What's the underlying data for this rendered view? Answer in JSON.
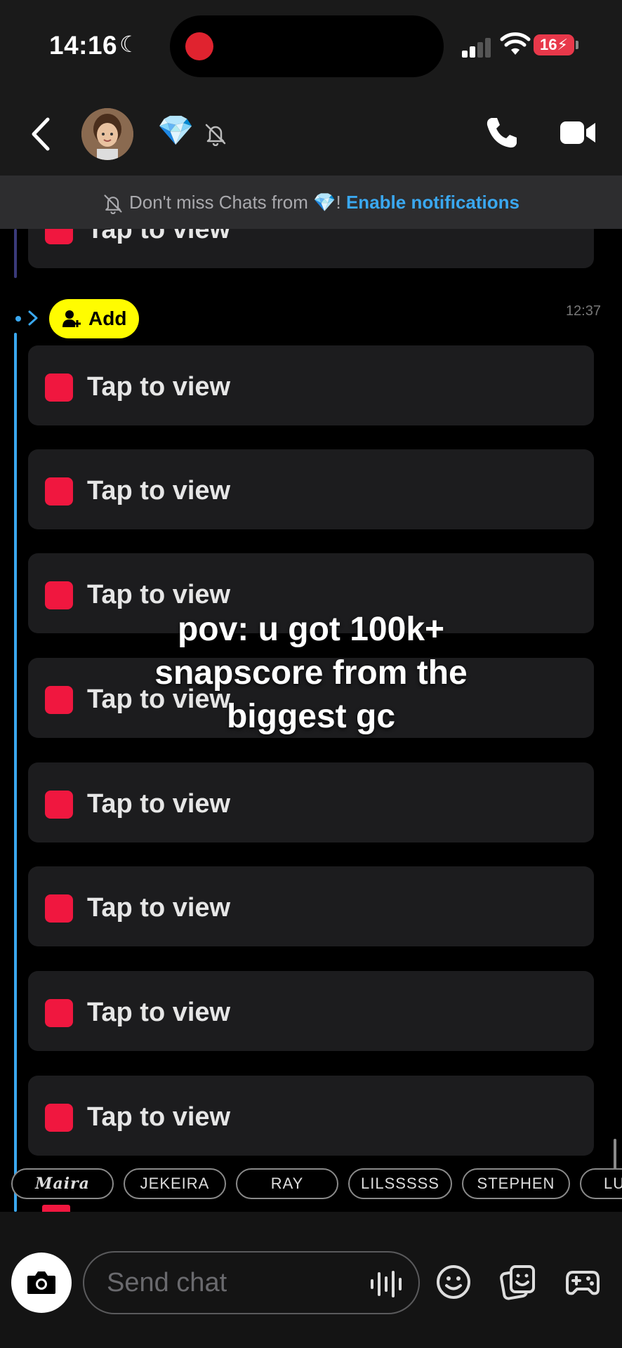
{
  "status_bar": {
    "time": "14:16",
    "battery": "16"
  },
  "header": {
    "gem_emoji": "💎",
    "icons": [
      "back-chevron-icon",
      "avatar",
      "bell-off-icon",
      "phone-icon",
      "video-icon"
    ]
  },
  "banner": {
    "prefix": "Don't miss Chats from ",
    "gem": "💎",
    "bang": "!",
    "link": "Enable notifications"
  },
  "chat": {
    "add_label": "Add",
    "timestamp": "12:37",
    "snap_label": "Tap to view",
    "snap_color": "#f0173f",
    "thread_color": "#3aa8f0"
  },
  "overlay_caption": [
    "pov: u got 100k+",
    "snapscore from the",
    "biggest gc"
  ],
  "members": [
    "Maira",
    "JEKEIRA",
    "RAY",
    "LILSSSSS",
    "STEPHEN",
    "LU"
  ],
  "composer": {
    "placeholder": "Send chat",
    "icons": [
      "camera-icon",
      "voice-icon",
      "emoji-icon",
      "sticker-icon",
      "game-icon"
    ]
  },
  "colors": {
    "accent_yellow": "#fffc00",
    "link_blue": "#3aa8f0",
    "snap_red": "#f0173f"
  }
}
